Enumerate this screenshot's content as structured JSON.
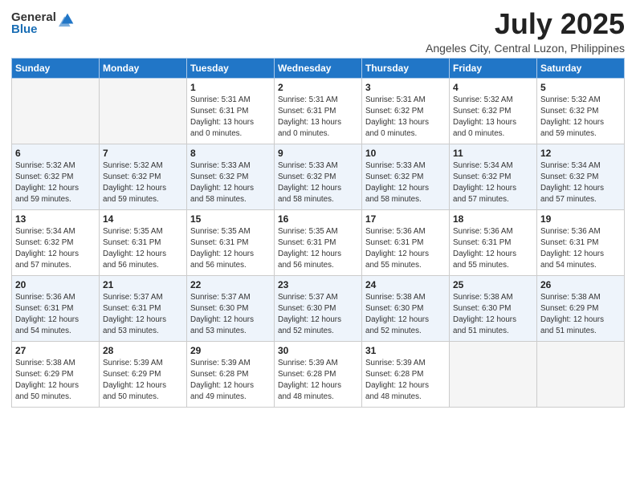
{
  "logo": {
    "general": "General",
    "blue": "Blue"
  },
  "title": "July 2025",
  "location": "Angeles City, Central Luzon, Philippines",
  "weekdays": [
    "Sunday",
    "Monday",
    "Tuesday",
    "Wednesday",
    "Thursday",
    "Friday",
    "Saturday"
  ],
  "weeks": [
    [
      {
        "day": "",
        "info": ""
      },
      {
        "day": "",
        "info": ""
      },
      {
        "day": "1",
        "info": "Sunrise: 5:31 AM\nSunset: 6:31 PM\nDaylight: 13 hours\nand 0 minutes."
      },
      {
        "day": "2",
        "info": "Sunrise: 5:31 AM\nSunset: 6:31 PM\nDaylight: 13 hours\nand 0 minutes."
      },
      {
        "day": "3",
        "info": "Sunrise: 5:31 AM\nSunset: 6:32 PM\nDaylight: 13 hours\nand 0 minutes."
      },
      {
        "day": "4",
        "info": "Sunrise: 5:32 AM\nSunset: 6:32 PM\nDaylight: 13 hours\nand 0 minutes."
      },
      {
        "day": "5",
        "info": "Sunrise: 5:32 AM\nSunset: 6:32 PM\nDaylight: 12 hours\nand 59 minutes."
      }
    ],
    [
      {
        "day": "6",
        "info": "Sunrise: 5:32 AM\nSunset: 6:32 PM\nDaylight: 12 hours\nand 59 minutes."
      },
      {
        "day": "7",
        "info": "Sunrise: 5:32 AM\nSunset: 6:32 PM\nDaylight: 12 hours\nand 59 minutes."
      },
      {
        "day": "8",
        "info": "Sunrise: 5:33 AM\nSunset: 6:32 PM\nDaylight: 12 hours\nand 58 minutes."
      },
      {
        "day": "9",
        "info": "Sunrise: 5:33 AM\nSunset: 6:32 PM\nDaylight: 12 hours\nand 58 minutes."
      },
      {
        "day": "10",
        "info": "Sunrise: 5:33 AM\nSunset: 6:32 PM\nDaylight: 12 hours\nand 58 minutes."
      },
      {
        "day": "11",
        "info": "Sunrise: 5:34 AM\nSunset: 6:32 PM\nDaylight: 12 hours\nand 57 minutes."
      },
      {
        "day": "12",
        "info": "Sunrise: 5:34 AM\nSunset: 6:32 PM\nDaylight: 12 hours\nand 57 minutes."
      }
    ],
    [
      {
        "day": "13",
        "info": "Sunrise: 5:34 AM\nSunset: 6:32 PM\nDaylight: 12 hours\nand 57 minutes."
      },
      {
        "day": "14",
        "info": "Sunrise: 5:35 AM\nSunset: 6:31 PM\nDaylight: 12 hours\nand 56 minutes."
      },
      {
        "day": "15",
        "info": "Sunrise: 5:35 AM\nSunset: 6:31 PM\nDaylight: 12 hours\nand 56 minutes."
      },
      {
        "day": "16",
        "info": "Sunrise: 5:35 AM\nSunset: 6:31 PM\nDaylight: 12 hours\nand 56 minutes."
      },
      {
        "day": "17",
        "info": "Sunrise: 5:36 AM\nSunset: 6:31 PM\nDaylight: 12 hours\nand 55 minutes."
      },
      {
        "day": "18",
        "info": "Sunrise: 5:36 AM\nSunset: 6:31 PM\nDaylight: 12 hours\nand 55 minutes."
      },
      {
        "day": "19",
        "info": "Sunrise: 5:36 AM\nSunset: 6:31 PM\nDaylight: 12 hours\nand 54 minutes."
      }
    ],
    [
      {
        "day": "20",
        "info": "Sunrise: 5:36 AM\nSunset: 6:31 PM\nDaylight: 12 hours\nand 54 minutes."
      },
      {
        "day": "21",
        "info": "Sunrise: 5:37 AM\nSunset: 6:31 PM\nDaylight: 12 hours\nand 53 minutes."
      },
      {
        "day": "22",
        "info": "Sunrise: 5:37 AM\nSunset: 6:30 PM\nDaylight: 12 hours\nand 53 minutes."
      },
      {
        "day": "23",
        "info": "Sunrise: 5:37 AM\nSunset: 6:30 PM\nDaylight: 12 hours\nand 52 minutes."
      },
      {
        "day": "24",
        "info": "Sunrise: 5:38 AM\nSunset: 6:30 PM\nDaylight: 12 hours\nand 52 minutes."
      },
      {
        "day": "25",
        "info": "Sunrise: 5:38 AM\nSunset: 6:30 PM\nDaylight: 12 hours\nand 51 minutes."
      },
      {
        "day": "26",
        "info": "Sunrise: 5:38 AM\nSunset: 6:29 PM\nDaylight: 12 hours\nand 51 minutes."
      }
    ],
    [
      {
        "day": "27",
        "info": "Sunrise: 5:38 AM\nSunset: 6:29 PM\nDaylight: 12 hours\nand 50 minutes."
      },
      {
        "day": "28",
        "info": "Sunrise: 5:39 AM\nSunset: 6:29 PM\nDaylight: 12 hours\nand 50 minutes."
      },
      {
        "day": "29",
        "info": "Sunrise: 5:39 AM\nSunset: 6:28 PM\nDaylight: 12 hours\nand 49 minutes."
      },
      {
        "day": "30",
        "info": "Sunrise: 5:39 AM\nSunset: 6:28 PM\nDaylight: 12 hours\nand 48 minutes."
      },
      {
        "day": "31",
        "info": "Sunrise: 5:39 AM\nSunset: 6:28 PM\nDaylight: 12 hours\nand 48 minutes."
      },
      {
        "day": "",
        "info": ""
      },
      {
        "day": "",
        "info": ""
      }
    ]
  ],
  "shaded_rows": [
    1,
    3
  ]
}
